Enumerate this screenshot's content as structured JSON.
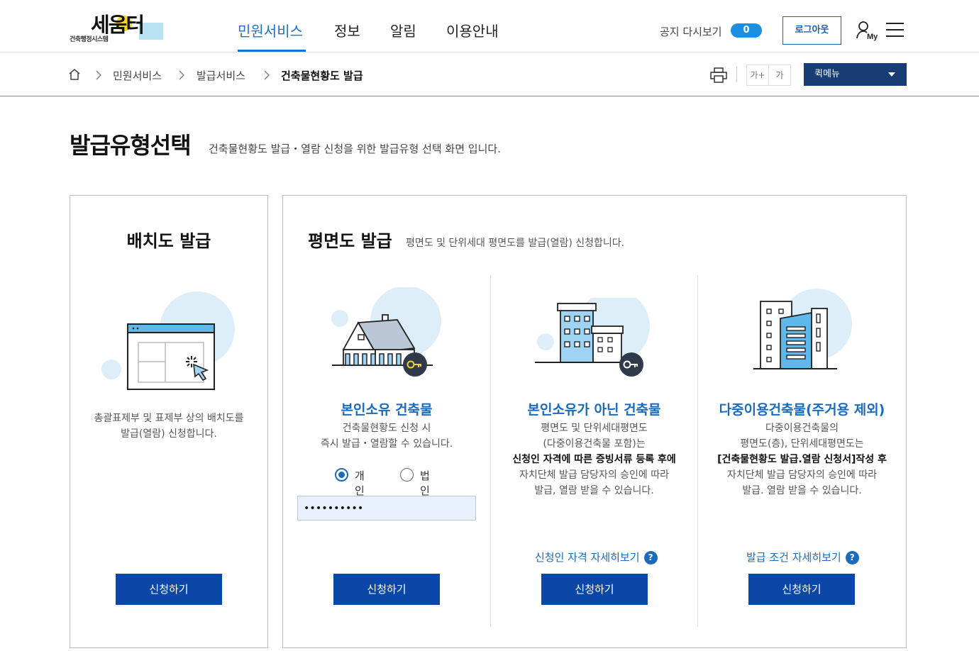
{
  "header": {
    "logo_title": "세움터",
    "logo_subtitle": "건축행정시스템",
    "menu": [
      "민원서비스",
      "정보",
      "알림",
      "이용안내"
    ],
    "notice_label": "공지 다시보기",
    "notice_count": "0",
    "logout_label": "로그아웃",
    "my_label": "My"
  },
  "breadcrumb": {
    "items": [
      "민원서비스",
      "발급서비스",
      "건축물현황도 발급"
    ],
    "font_up": "가+",
    "font_reset": "가",
    "quick_menu": "퀵메뉴"
  },
  "page": {
    "title": "발급유형선택",
    "desc": "건축물현황도 발급・열람 신청을 위한 발급유형 선택 화면 입니다."
  },
  "left_panel": {
    "title": "배치도 발급",
    "text": [
      "총괄표제부 및 표제부 상의 배치도를",
      "발급(열람) 신청합니다."
    ],
    "button": "신청하기"
  },
  "right_panel": {
    "title": "평면도 발급",
    "desc": "평면도 및 단위세대 평면도를 발급(열람) 신청합니다.",
    "cards": [
      {
        "title": "본인소유 건축물",
        "text": [
          "건축물현황도 신청 시",
          "즉시 발급・열람할 수 있습니다."
        ],
        "radio_personal": "개인",
        "radio_corp": "법인",
        "password_value": "••••••••••",
        "button": "신청하기"
      },
      {
        "title": "본인소유가 아닌 건축물",
        "text": [
          "평면도 및 단위세대평면도",
          "(다중이용건축물 포함)는",
          "신청인 자격에 따른 증빙서류 등록 후에",
          "자치단체 발급 담당자의 승인에 따라",
          "발급, 열람 받을 수 있습니다."
        ],
        "link": "신청인 자격 자세히보기",
        "button": "신청하기"
      },
      {
        "title": "다중이용건축물(주거용 제외)",
        "text": [
          "다중이용건축물의",
          "평면도(층), 단위세대평면도는",
          "[건축물현황도 발급.열람 신청서]작성 후",
          "자치단체 발급 담당자의 승인에 따라",
          "발급. 열람 받을 수 있습니다."
        ],
        "link": "발급 조건 자세히보기",
        "button": "신청하기"
      }
    ]
  },
  "icons": {
    "question": "?",
    "accent": "#1a6bbd",
    "button_bg": "#0b47a6",
    "quick_bg": "#183d74"
  }
}
